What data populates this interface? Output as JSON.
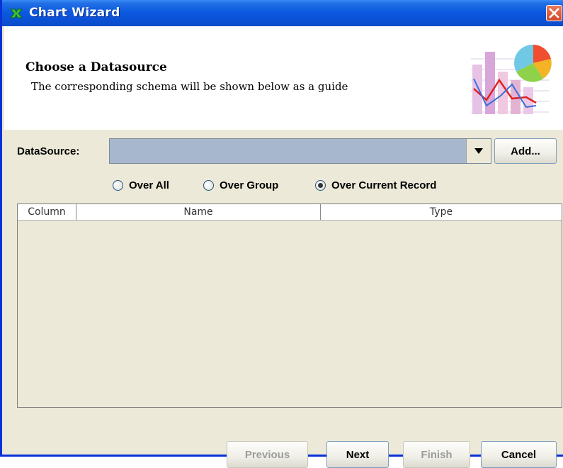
{
  "window": {
    "title": "Chart Wizard"
  },
  "header": {
    "title": "Choose a Datasource",
    "subtitle": "The corresponding schema will be shown below as a guide"
  },
  "datasource": {
    "label": "DataSource:",
    "selected_value": "",
    "add_label": "Add..."
  },
  "scope": {
    "options": [
      {
        "label": "Over All",
        "selected": false
      },
      {
        "label": "Over Group",
        "selected": false
      },
      {
        "label": "Over Current Record",
        "selected": true
      }
    ]
  },
  "schema_table": {
    "columns": [
      "Column",
      "Name",
      "Type"
    ],
    "rows": []
  },
  "buttons": {
    "previous": "Previous",
    "next": "Next",
    "finish": "Finish",
    "cancel": "Cancel"
  }
}
